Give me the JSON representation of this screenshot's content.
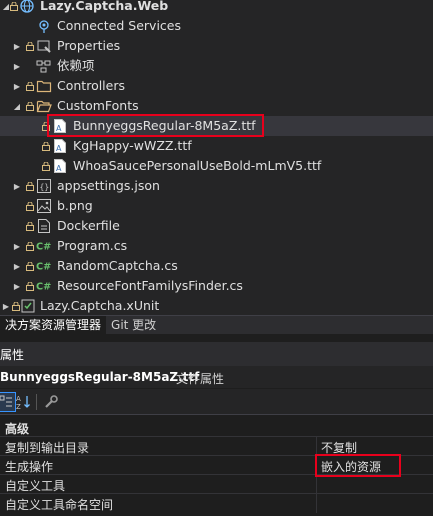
{
  "tree": {
    "project": "Lazy.Captcha.Web",
    "items": [
      {
        "label": "Connected Services"
      },
      {
        "label": "Properties"
      },
      {
        "label": "依赖项"
      },
      {
        "label": "Controllers"
      },
      {
        "label": "CustomFonts"
      },
      {
        "label": "BunnyeggsRegular-8M5aZ.ttf"
      },
      {
        "label": "KgHappy-wWZZ.ttf"
      },
      {
        "label": "WhoaSaucePersonalUseBold-mLmV5.ttf"
      },
      {
        "label": "appsettings.json"
      },
      {
        "label": "b.png"
      },
      {
        "label": "Dockerfile"
      },
      {
        "label": "Program.cs"
      },
      {
        "label": "RandomCaptcha.cs"
      },
      {
        "label": "ResourceFontFamilysFinder.cs"
      }
    ],
    "next_project": "Lazy.Captcha.xUnit"
  },
  "tabs": [
    {
      "label": "决方案资源管理器"
    },
    {
      "label": "Git 更改"
    }
  ],
  "properties": {
    "title": "属性",
    "object_name": "BunnyeggsRegular-8M5aZ.ttf",
    "object_kind": "文件属性",
    "category": "高级",
    "rows": [
      {
        "name": "复制到输出目录",
        "value": "不复制"
      },
      {
        "name": "生成操作",
        "value": "嵌入的资源"
      },
      {
        "name": "自定义工具",
        "value": ""
      },
      {
        "name": "自定义工具命名空间",
        "value": ""
      }
    ]
  },
  "colors": {
    "highlight": "#e8001c",
    "lock": "#d7ba7d",
    "folder": "#dcb67a",
    "csharp": "#68c06d"
  }
}
